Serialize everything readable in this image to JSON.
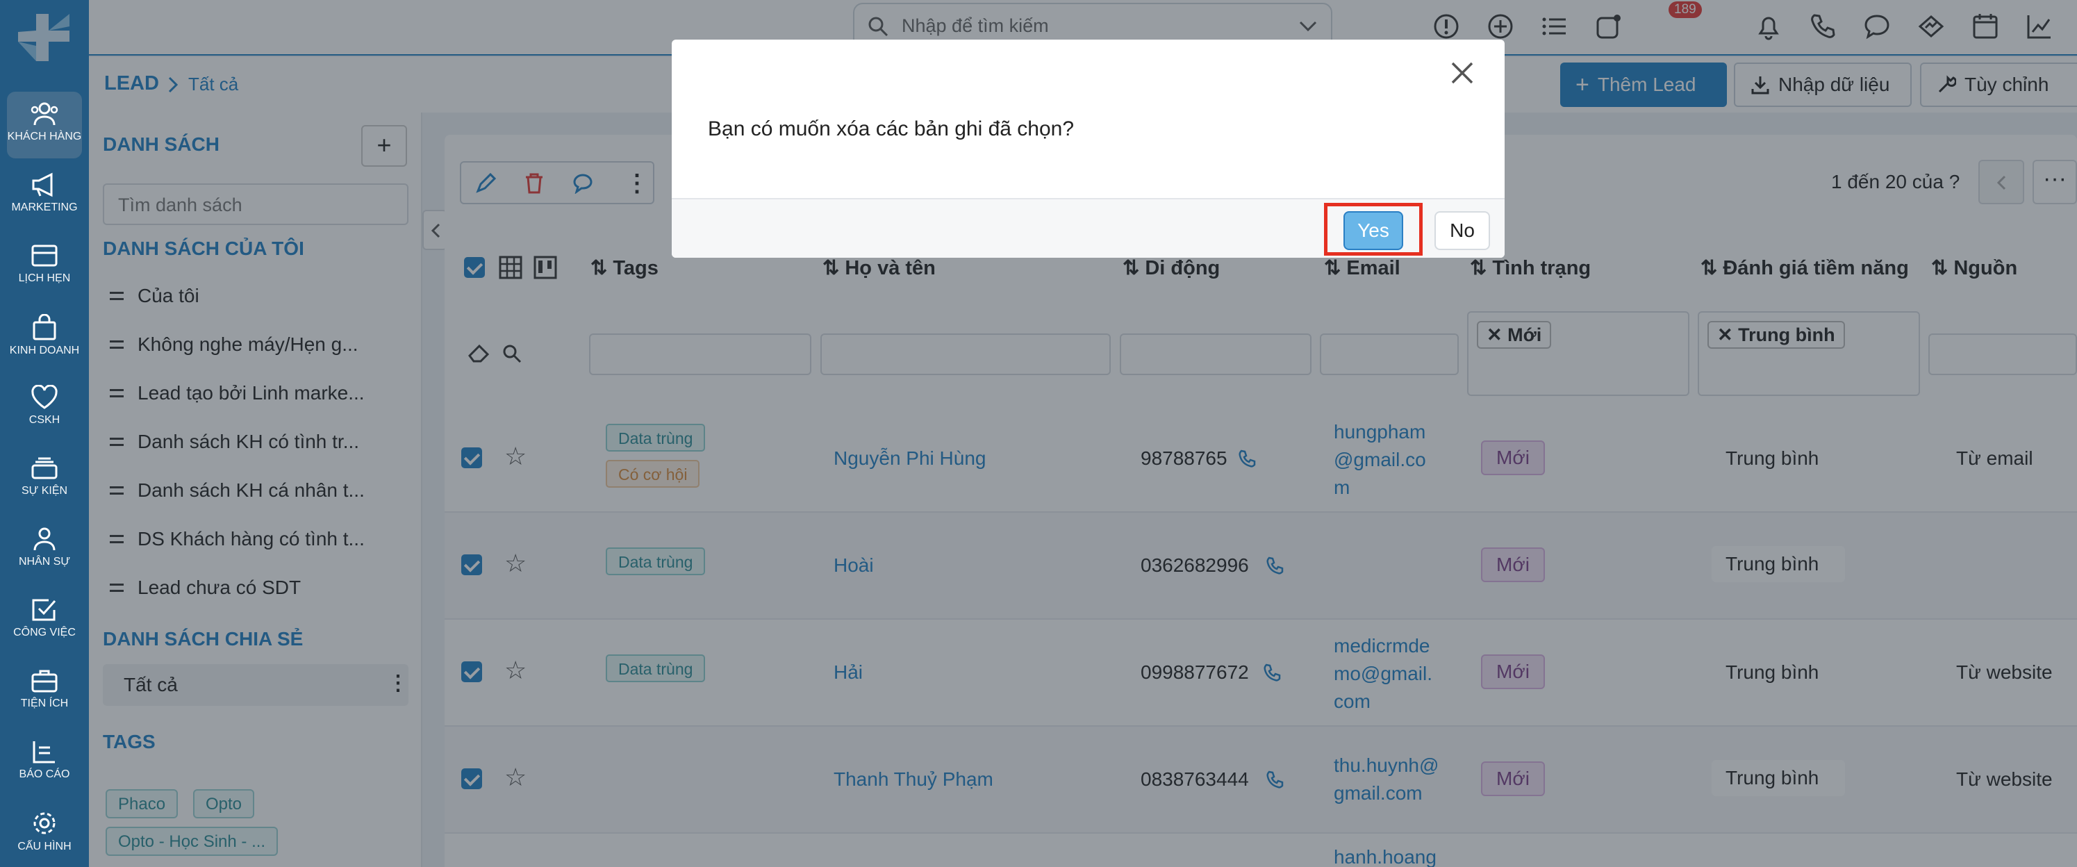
{
  "nav": {
    "items": [
      {
        "label": "KHÁCH HÀNG",
        "icon": "users-icon"
      },
      {
        "label": "MARKETING",
        "icon": "megaphone-icon"
      },
      {
        "label": "LỊCH HẸN",
        "icon": "calendar-card-icon"
      },
      {
        "label": "KINH DOANH",
        "icon": "shopping-bag-icon"
      },
      {
        "label": "CSKH",
        "icon": "heart-icon"
      },
      {
        "label": "SỰ KIỆN",
        "icon": "layers-icon"
      },
      {
        "label": "NHÂN SỰ",
        "icon": "person-icon"
      },
      {
        "label": "CÔNG VIỆC",
        "icon": "task-check-icon"
      },
      {
        "label": "TIỆN ÍCH",
        "icon": "briefcase-icon"
      },
      {
        "label": "BÁO CÁO",
        "icon": "report-icon"
      },
      {
        "label": "CẤU HÌNH",
        "icon": "gear-icon"
      }
    ]
  },
  "topbar": {
    "search_placeholder": "Nhập để tìm kiếm",
    "notification_count": "189"
  },
  "breadcrumb": {
    "root": "LEAD",
    "current": "Tất cả"
  },
  "actions": {
    "add_lead": "Thêm Lead",
    "import": "Nhập dữ liệu",
    "customize": "Tùy chỉnh"
  },
  "sidebar": {
    "lists_title": "DANH SÁCH",
    "search_placeholder": "Tìm danh sách",
    "my_lists_title": "DANH SÁCH CỦA TÔI",
    "my_lists": [
      "Của tôi",
      "Không nghe máy/Hẹn g...",
      "Lead tạo bởi Linh marke...",
      "Danh sách KH có tình tr...",
      "Danh sách KH cá nhân t...",
      "DS Khách hàng có tình t...",
      "Lead chưa có SDT"
    ],
    "shared_title": "DANH SÁCH CHIA SẺ",
    "shared_item": "Tất cả",
    "tags_title": "TAGS",
    "tags": [
      "Phaco",
      "Opto",
      "Opto - Học Sinh - ..."
    ]
  },
  "table": {
    "pagination": "1 đến 20 của ?",
    "columns": {
      "tags": "Tags",
      "name": "Họ và tên",
      "mobile": "Di động",
      "email": "Email",
      "status": "Tình trạng",
      "potential": "Đánh giá tiềm năng",
      "source": "Nguồn"
    },
    "filters": {
      "status": "Mới",
      "potential": "Trung bình"
    },
    "rows": [
      {
        "tags": [
          "Data trùng",
          "Có cơ hội"
        ],
        "name": "Nguyễn Phi Hùng",
        "mobile": "98788765",
        "email": [
          "hungpham",
          "@gmail.co",
          "m"
        ],
        "status": "Mới",
        "potential": "Trung bình",
        "source": "Từ email"
      },
      {
        "tags": [
          "Data trùng"
        ],
        "name": "Hoài",
        "mobile": "0362682996",
        "email": [],
        "status": "Mới",
        "potential": "Trung bình",
        "source": ""
      },
      {
        "tags": [
          "Data trùng"
        ],
        "name": "Hải",
        "mobile": "0998877672",
        "email": [
          "medicrmde",
          "mo@gmail.",
          "com"
        ],
        "status": "Mới",
        "potential": "Trung bình",
        "source": "Từ website"
      },
      {
        "tags": [],
        "name": "Thanh Thuỷ Phạm",
        "mobile": "0838763444",
        "email": [
          "thu.huynh@",
          "gmail.com"
        ],
        "status": "Mới",
        "potential": "Trung bình",
        "source": "Từ website"
      },
      {
        "tags": [],
        "name": "",
        "mobile": "",
        "email": [
          "hanh.hoang"
        ],
        "status": "",
        "potential": "",
        "source": ""
      }
    ]
  },
  "dialog": {
    "message": "Bạn có muốn xóa các bản ghi đã chọn?",
    "yes": "Yes",
    "no": "No"
  },
  "colors": {
    "primary": "#1f7fc4",
    "highlight": "#e53021"
  }
}
